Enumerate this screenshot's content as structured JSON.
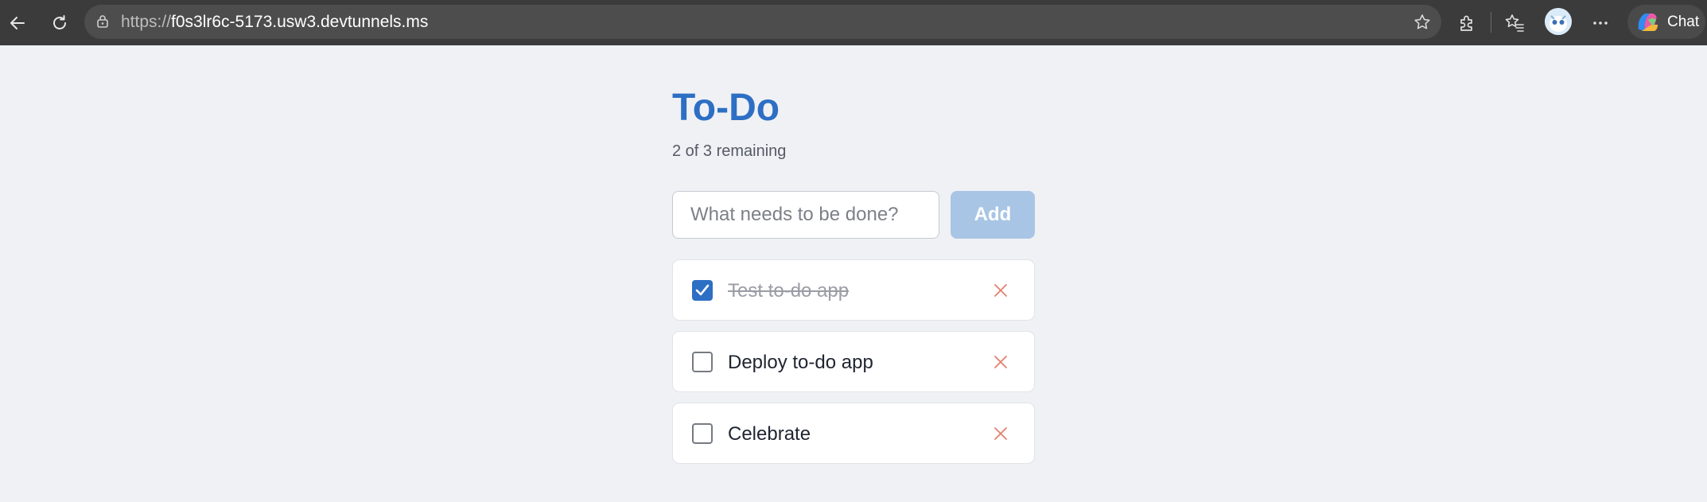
{
  "browser": {
    "url_scheme": "https://",
    "url_host": "f0s3lr6c-5173.usw3.devtunnels.ms",
    "chat_label": "Chat",
    "icons": [
      "back-icon",
      "refresh-icon",
      "site-info-icon",
      "favorite-star-icon",
      "extensions-icon",
      "favorites-icon",
      "profile-avatar",
      "more-icon",
      "copilot-icon"
    ]
  },
  "app": {
    "title": "To-Do",
    "remaining": "2 of 3 remaining",
    "input_placeholder": "What needs to be done?",
    "input_value": "",
    "add_label": "Add",
    "todos": [
      {
        "text": "Test to-do app",
        "done": true
      },
      {
        "text": "Deploy to-do app",
        "done": false
      },
      {
        "text": "Celebrate",
        "done": false
      }
    ]
  },
  "colors": {
    "accent": "#2d6fc4",
    "add_button": "#a8c5e5",
    "delete_icon": "#e2806f",
    "background": "#f0f1f5"
  }
}
